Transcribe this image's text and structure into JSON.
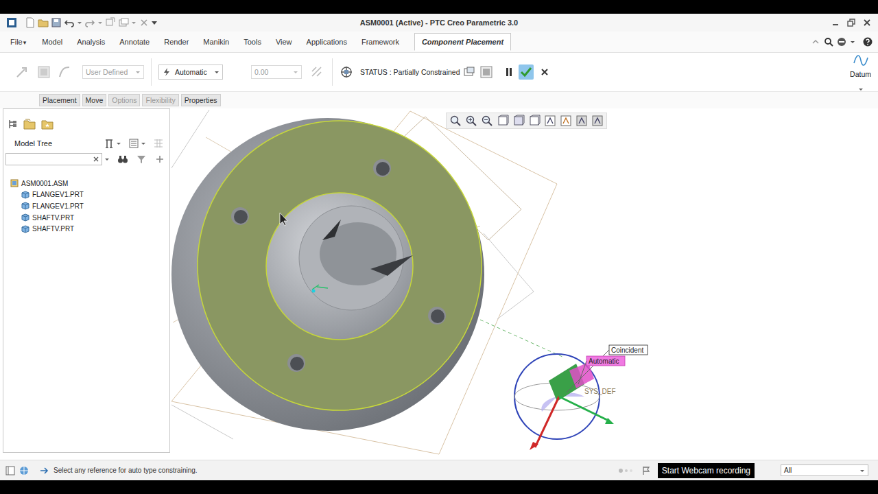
{
  "window": {
    "title": "ASM0001 (Active) - PTC Creo Parametric 3.0"
  },
  "file_menu": {
    "label": "File",
    "arrow": "▾"
  },
  "tabs": [
    {
      "label": "Model",
      "selected": false
    },
    {
      "label": "Analysis",
      "selected": false
    },
    {
      "label": "Annotate",
      "selected": false
    },
    {
      "label": "Render",
      "selected": false
    },
    {
      "label": "Manikin",
      "selected": false
    },
    {
      "label": "Tools",
      "selected": false
    },
    {
      "label": "View",
      "selected": false
    },
    {
      "label": "Applications",
      "selected": false
    },
    {
      "label": "Framework",
      "selected": false
    },
    {
      "label": "Component Placement",
      "selected": true
    }
  ],
  "ribbon": {
    "constraint_set": {
      "value": "User Defined",
      "disabled": true
    },
    "constraint_type": {
      "value": "Automatic",
      "disabled": false
    },
    "offset": {
      "value": "0.00",
      "disabled": true
    },
    "status": "STATUS : Partially Constrained",
    "datum": "Datum"
  },
  "sub_tabs": [
    {
      "label": "Placement",
      "disabled": false
    },
    {
      "label": "Move",
      "disabled": false
    },
    {
      "label": "Options",
      "disabled": true
    },
    {
      "label": "Flexibility",
      "disabled": true
    },
    {
      "label": "Properties",
      "disabled": false
    }
  ],
  "model_tree": {
    "title": "Model Tree",
    "search": {
      "value": ""
    },
    "items": [
      {
        "label": "ASM0001.ASM",
        "kind": "assembly",
        "depth": 0
      },
      {
        "label": "FLANGEV1.PRT",
        "kind": "part",
        "depth": 1
      },
      {
        "label": "FLANGEV1.PRT",
        "kind": "part",
        "depth": 1
      },
      {
        "label": "SHAFTV.PRT",
        "kind": "part",
        "depth": 1
      },
      {
        "label": "SHAFTV.PRT",
        "kind": "part",
        "depth": 1
      }
    ]
  },
  "viewport": {
    "face_highlighted": true,
    "tags": [
      {
        "label": "Coincident",
        "selected": false
      },
      {
        "label": "Automatic",
        "selected": true
      }
    ],
    "csys_label": "SYS_DEF"
  },
  "status_bar": {
    "message": "Select any reference for auto type constraining.",
    "tooltip": "Start Webcam recording",
    "filter": "All"
  }
}
